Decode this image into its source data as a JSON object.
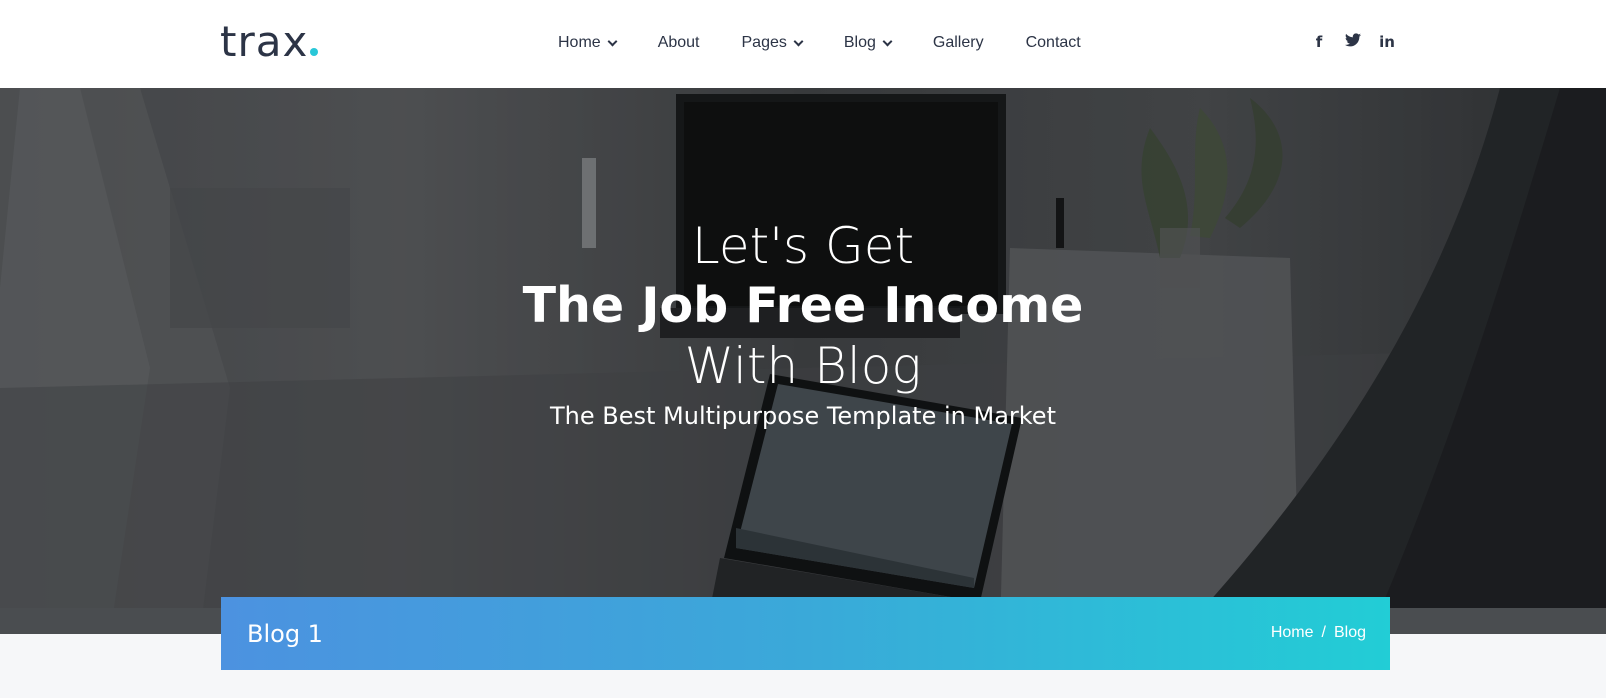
{
  "logo": {
    "text": "trax"
  },
  "nav": {
    "items": [
      {
        "label": "Home",
        "dropdown": true
      },
      {
        "label": "About",
        "dropdown": false
      },
      {
        "label": "Pages",
        "dropdown": true
      },
      {
        "label": "Blog",
        "dropdown": true
      },
      {
        "label": "Gallery",
        "dropdown": false
      },
      {
        "label": "Contact",
        "dropdown": false
      }
    ]
  },
  "social": {
    "icons": [
      {
        "name": "facebook-icon",
        "glyph": "f"
      },
      {
        "name": "twitter-icon",
        "glyph": "t"
      },
      {
        "name": "linkedin-icon",
        "glyph": "in"
      }
    ]
  },
  "hero": {
    "line1": "Let's Get",
    "line2": "The Job Free Income",
    "line3": "With Blog",
    "subtitle": "The Best Multipurpose Template in Market"
  },
  "page_title": {
    "title": "Blog 1",
    "breadcrumb": {
      "home": "Home",
      "separator": "/",
      "current": "Blog"
    }
  },
  "colors": {
    "accent": "#29c7d8",
    "text_dark": "#2c3446",
    "gradient_start": "#4c92e0",
    "gradient_end": "#22cdd6"
  }
}
